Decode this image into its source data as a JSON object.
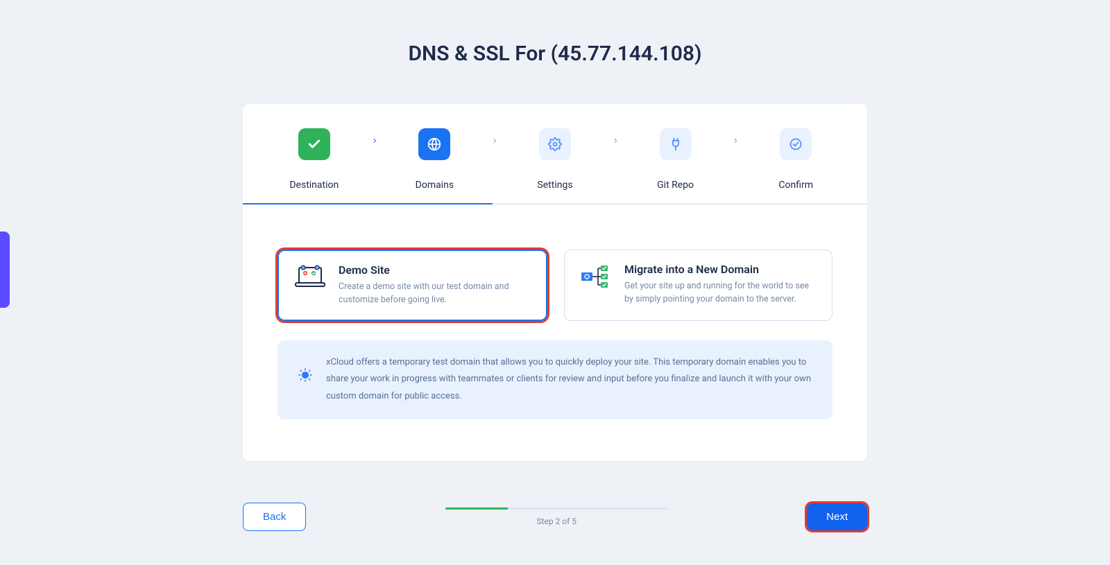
{
  "title": "DNS & SSL For (45.77.144.108)",
  "steps": [
    {
      "label": "Destination",
      "state": "completed"
    },
    {
      "label": "Domains",
      "state": "active"
    },
    {
      "label": "Settings",
      "state": "pending"
    },
    {
      "label": "Git Repo",
      "state": "pending"
    },
    {
      "label": "Confirm",
      "state": "pending"
    }
  ],
  "options": {
    "demo": {
      "title": "Demo Site",
      "desc": "Create a demo site with our test domain and customize before going live."
    },
    "migrate": {
      "title": "Migrate into a New Domain",
      "desc": "Get your site up and running for the world to see by simply pointing your domain to the server."
    }
  },
  "info_text": "xCloud offers a temporary test domain that allows you to quickly deploy your site. This temporary domain enables you to share your work in progress with teammates or clients for review and input before you finalize and launch it with your own custom domain for public access.",
  "footer": {
    "back": "Back",
    "next": "Next",
    "step_label": "Step 2 of 5",
    "progress_percent": 28
  }
}
